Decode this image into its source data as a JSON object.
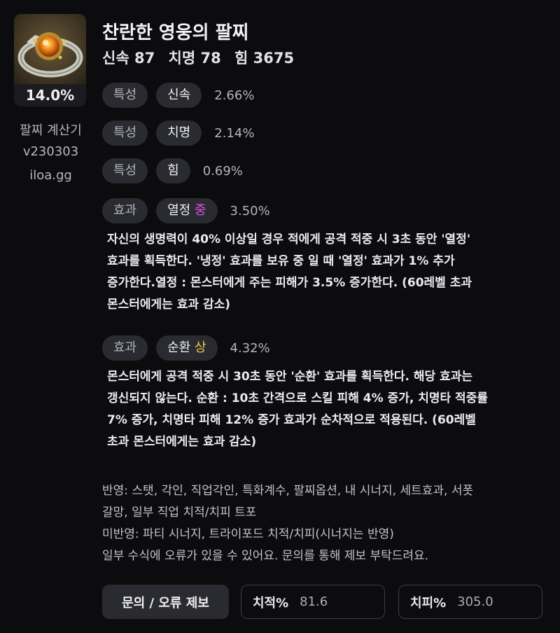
{
  "item": {
    "title": "찬란한 영웅의 팔찌",
    "percent": "14.0%",
    "stats": [
      "신속 87",
      "치명 78",
      "힘 3675"
    ]
  },
  "sidebar": {
    "lines": [
      "팔찌 계산기",
      "v230303",
      "iloa.gg"
    ]
  },
  "effects": [
    {
      "kind": "특성",
      "name": "신속",
      "grade": "",
      "pct": "2.66%"
    },
    {
      "kind": "특성",
      "name": "치명",
      "grade": "",
      "pct": "2.14%"
    },
    {
      "kind": "특성",
      "name": "힘",
      "grade": "",
      "pct": "0.69%"
    },
    {
      "kind": "효과",
      "name": "열정",
      "grade": "중",
      "pct": "3.50%"
    },
    {
      "kind": "효과",
      "name": "순환",
      "grade": "상",
      "pct": "4.32%"
    }
  ],
  "descriptions": {
    "passion": [
      "자신의 생명력이 40% 이상일 경우 적에게 공격 적중 시 3초 동안 '열정'",
      "효과를 획득한다. '냉정' 효과를 보유 중 일 때 '열정' 효과가 1% 추가",
      "증가한다.열정 : 몬스터에게 주는 피해가 3.5% 증가한다. (60레벨 초과",
      "몬스터에게는 효과 감소)"
    ],
    "cycle": [
      "몬스터에게 공격 적중 시 30초 동안 '순환' 효과를 획득한다. 해당 효과는",
      "갱신되지 않는다. 순환 : 10초 간격으로 스킬 피해 4% 증가, 치명타 적중률",
      "7% 증가, 치명타 피해 12% 증가 효과가 순차적으로 적용된다. (60레벨",
      "초과 몬스터에게는 효과 감소)"
    ]
  },
  "footnotes": [
    "반영: 스탯, 각인, 직업각인, 특화계수, 팔찌옵션, 내 시너지, 세트효과, 서폿",
    "갈망, 일부 직업 치적/치피 트포",
    "미반영: 파티 시너지, 트라이포드 치적/치피(시너지는 반영)",
    "일부 수식에 오류가 있을 수 있어요. 문의를 통해 제보 부탁드려요."
  ],
  "actions": {
    "report_label": "문의 / 오류 제보"
  },
  "inputs": {
    "crit_rate": {
      "label": "치적%",
      "value": "81.6"
    },
    "crit_damage": {
      "label": "치피%",
      "value": "305.0"
    }
  },
  "colors": {
    "background": "#0c0c0e",
    "pill": "#2a2b30",
    "grade_mid": "#e04fe8",
    "grade_high": "#f2c64b"
  }
}
